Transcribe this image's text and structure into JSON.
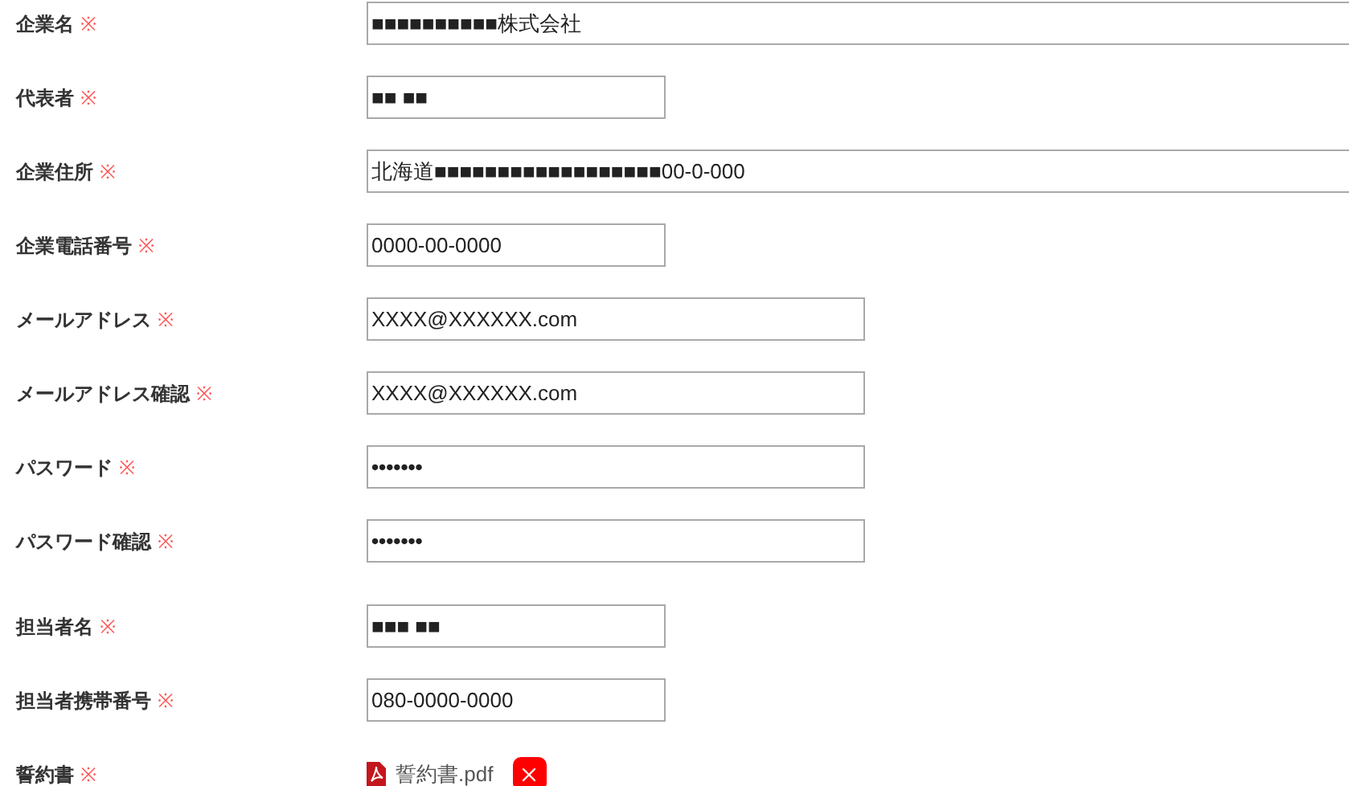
{
  "sections": [
    {
      "rows": [
        {
          "label": "企業名",
          "required_mark": "※",
          "kind": "wide",
          "value": "■■■■■■■■■■株式会社"
        },
        {
          "label": "代表者",
          "required_mark": "※",
          "kind": "short",
          "value": "■■ ■■"
        },
        {
          "label": "企業住所",
          "required_mark": "※",
          "kind": "wide",
          "value": "北海道■■■■■■■■■■■■■■■■■■00-0-000"
        },
        {
          "label": "企業電話番号",
          "required_mark": "※",
          "kind": "short",
          "value": "0000-00-0000"
        },
        {
          "label": "メールアドレス",
          "required_mark": "※",
          "kind": "medium",
          "value": "XXXX@XXXXXX.com"
        },
        {
          "label": "メールアドレス確認",
          "required_mark": "※",
          "kind": "medium",
          "value": "XXXX@XXXXXX.com"
        },
        {
          "label": "パスワード",
          "required_mark": "※",
          "kind": "password",
          "value": "•••••••"
        },
        {
          "label": "パスワード確認",
          "required_mark": "※",
          "kind": "password",
          "value": "•••••••"
        }
      ]
    },
    {
      "rows": [
        {
          "label": "担当者名",
          "required_mark": "※",
          "kind": "short",
          "value": "■■■ ■■"
        },
        {
          "label": "担当者携帯番号",
          "required_mark": "※",
          "kind": "short",
          "value": "080-0000-0000"
        },
        {
          "label": "誓約書",
          "required_mark": "※",
          "kind": "file",
          "filename": "誓約書.pdf"
        }
      ]
    }
  ]
}
